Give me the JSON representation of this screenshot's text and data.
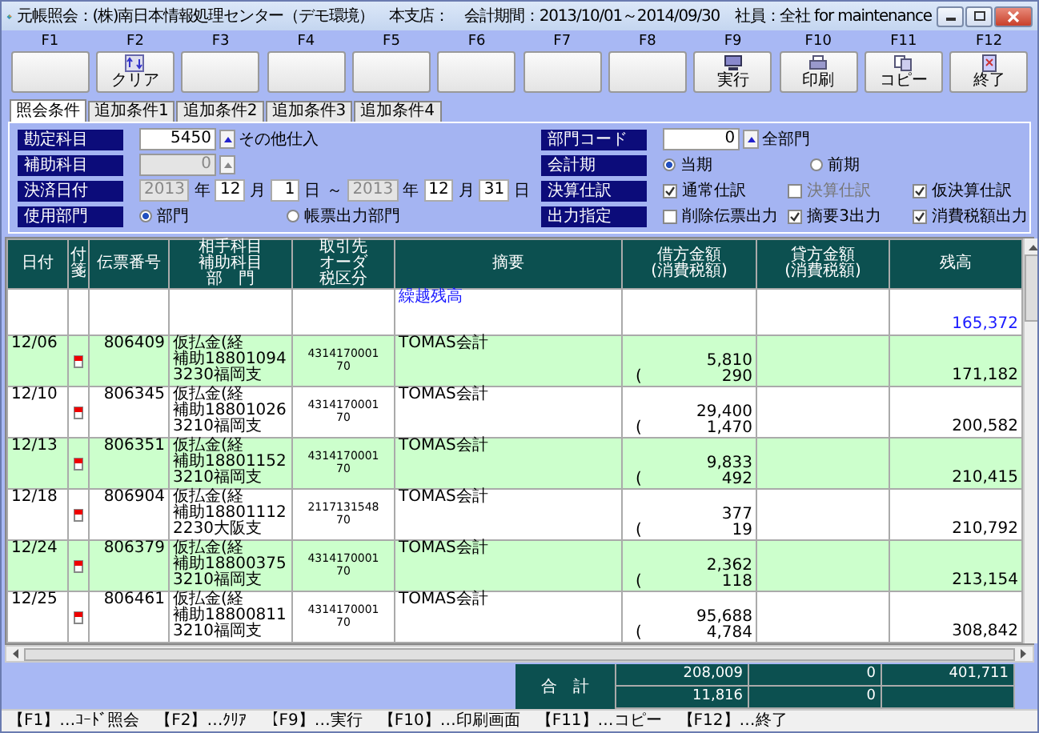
{
  "window": {
    "title": "元帳照会：(株)南日本情報処理センター（デモ環境）　本支店：　会計期間：2013/10/01～2014/09/30　社員：全社 for maintenance"
  },
  "fkeys": [
    {
      "key": "F1"
    },
    {
      "key": "F2",
      "label": "クリア",
      "kind": "clear"
    },
    {
      "key": "F3"
    },
    {
      "key": "F4"
    },
    {
      "key": "F5"
    },
    {
      "key": "F6"
    },
    {
      "key": "F7"
    },
    {
      "key": "F8"
    },
    {
      "key": "F9",
      "label": "実行",
      "kind": "execute"
    },
    {
      "key": "F10",
      "label": "印刷",
      "kind": "print"
    },
    {
      "key": "F11",
      "label": "コピー",
      "kind": "copy"
    },
    {
      "key": "F12",
      "label": "終了",
      "kind": "exit"
    }
  ],
  "tabs": [
    {
      "label": "照会条件",
      "selected": true
    },
    {
      "label": "追加条件1",
      "selected": false
    },
    {
      "label": "追加条件2",
      "selected": false
    },
    {
      "label": "追加条件3",
      "selected": false
    },
    {
      "label": "追加条件4",
      "selected": false
    }
  ],
  "conditions": {
    "account": {
      "label": "勘定科目",
      "value": "5450",
      "name": "その他仕入"
    },
    "sub_account": {
      "label": "補助科目",
      "value": "0",
      "disabled": true
    },
    "date_range": {
      "label": "決済日付",
      "from": {
        "year": "2013",
        "year_unit": "年",
        "month": "12",
        "month_unit": "月",
        "day": "1",
        "day_unit": "日"
      },
      "separator": "～",
      "to": {
        "year": "2013",
        "year_unit": "年",
        "month": "12",
        "month_unit": "月",
        "day": "31",
        "day_unit": "日"
      }
    },
    "dept_use": {
      "label": "使用部門",
      "options": [
        {
          "label": "部門",
          "selected": true
        },
        {
          "label": "帳票出力部門",
          "selected": false
        }
      ]
    },
    "dept_code": {
      "label": "部門コード",
      "value": "0",
      "name": "全部門"
    },
    "period": {
      "label": "会計期",
      "options": [
        {
          "label": "当期",
          "selected": true
        },
        {
          "label": "前期",
          "selected": false
        }
      ]
    },
    "closing": {
      "label": "決算仕訳",
      "options": [
        {
          "label": "通常仕訳",
          "checked": true,
          "disabled": false
        },
        {
          "label": "決算仕訳",
          "checked": false,
          "disabled": true
        },
        {
          "label": "仮決算仕訳",
          "checked": true,
          "disabled": false
        }
      ]
    },
    "output": {
      "label": "出力指定",
      "options": [
        {
          "label": "削除伝票出力",
          "checked": false,
          "disabled": false
        },
        {
          "label": "摘要3出力",
          "checked": true,
          "disabled": false
        },
        {
          "label": "消費税額出力",
          "checked": true,
          "disabled": false
        }
      ]
    }
  },
  "table": {
    "columns": [
      [
        "日付"
      ],
      [
        "付箋"
      ],
      [
        "伝票番号"
      ],
      [
        "相手科目",
        "補助科目",
        "部　門"
      ],
      [
        "取引先",
        "オーダ",
        "税区分"
      ],
      [
        "摘要"
      ],
      [
        "借方金額",
        "(消費税額)"
      ],
      [
        "貸方金額",
        "(消費税額)"
      ],
      [
        "残高"
      ]
    ],
    "rows": [
      {
        "kind": "opening",
        "summary": "繰越残高",
        "balance": "165,372"
      },
      {
        "kind": "entry",
        "date": "12/06",
        "voucher": "806409",
        "counter": [
          "仮払金(経",
          "補助18801094",
          "3230福岡支"
        ],
        "partner": [
          "4314170001",
          "70"
        ],
        "summary": "TOMAS会計",
        "debit": "5,810",
        "tax_mark": "(",
        "debit_tax": "290",
        "balance": "171,182"
      },
      {
        "kind": "entry",
        "date": "12/10",
        "voucher": "806345",
        "counter": [
          "仮払金(経",
          "補助18801026",
          "3210福岡支"
        ],
        "partner": [
          "4314170001",
          "70"
        ],
        "summary": "TOMAS会計",
        "debit": "29,400",
        "tax_mark": "(",
        "debit_tax": "1,470",
        "balance": "200,582"
      },
      {
        "kind": "entry",
        "date": "12/13",
        "voucher": "806351",
        "counter": [
          "仮払金(経",
          "補助18801152",
          "3210福岡支"
        ],
        "partner": [
          "4314170001",
          "70"
        ],
        "summary": "TOMAS会計",
        "debit": "9,833",
        "tax_mark": "(",
        "debit_tax": "492",
        "balance": "210,415"
      },
      {
        "kind": "entry",
        "date": "12/18",
        "voucher": "806904",
        "counter": [
          "仮払金(経",
          "補助18801112",
          "2230大阪支"
        ],
        "partner": [
          "2117131548",
          "70"
        ],
        "summary": "TOMAS会計",
        "debit": "377",
        "tax_mark": "(",
        "debit_tax": "19",
        "balance": "210,792"
      },
      {
        "kind": "entry",
        "date": "12/24",
        "voucher": "806379",
        "counter": [
          "仮払金(経",
          "補助18800375",
          "3210福岡支"
        ],
        "partner": [
          "4314170001",
          "70"
        ],
        "summary": "TOMAS会計",
        "debit": "2,362",
        "tax_mark": "(",
        "debit_tax": "118",
        "balance": "213,154"
      },
      {
        "kind": "entry",
        "date": "12/25",
        "voucher": "806461",
        "counter": [
          "仮払金(経",
          "補助18800811",
          "3210福岡支"
        ],
        "partner": [
          "4314170001",
          "70"
        ],
        "summary": "TOMAS会計",
        "debit": "95,688",
        "tax_mark": "(",
        "debit_tax": "4,784",
        "balance": "308,842"
      }
    ]
  },
  "totals": {
    "label": "合　計",
    "debit": "208,009",
    "credit": "0",
    "balance": "401,711",
    "debit_tax": "11,816",
    "credit_tax": "0"
  },
  "status_bar": "【F1】…ｺｰﾄﾞ照会　【F2】…ｸﾘｱ　【F9】…実行　【F10】…印刷画面　【F11】…コピー　【F12】…終了"
}
